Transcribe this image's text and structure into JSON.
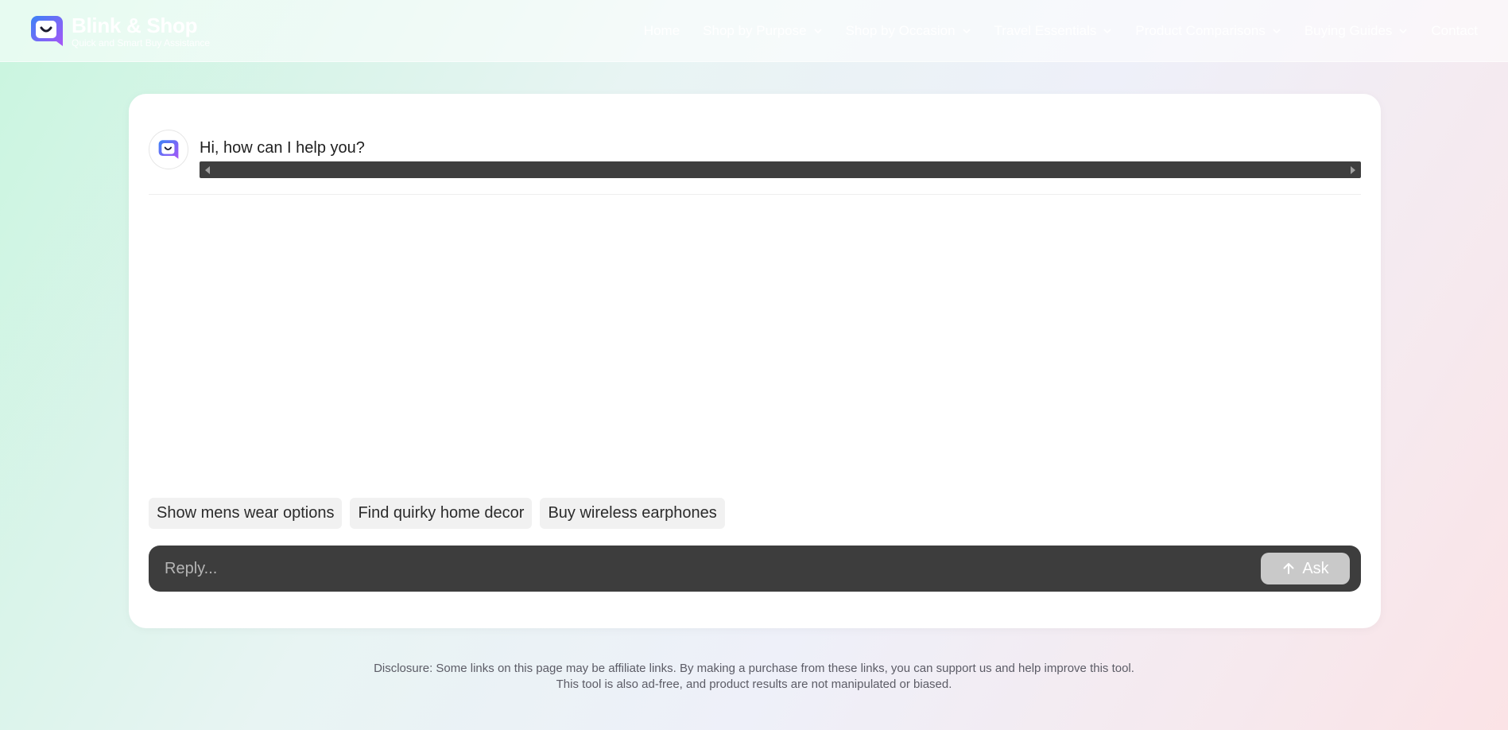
{
  "header": {
    "brand_name": "Blink & Shop",
    "tagline": "Quick and Smart Buy Assistance",
    "logo_icon": "smile-chat-icon",
    "nav": [
      {
        "label": "Home",
        "has_dropdown": false
      },
      {
        "label": "Shop by Purpose",
        "has_dropdown": true
      },
      {
        "label": "Shop by Occasion",
        "has_dropdown": true
      },
      {
        "label": "Travel Essentials",
        "has_dropdown": true
      },
      {
        "label": "Product Comparisons",
        "has_dropdown": true
      },
      {
        "label": "Buying Guides",
        "has_dropdown": true
      },
      {
        "label": "Contact",
        "has_dropdown": false
      }
    ]
  },
  "chat": {
    "greeting": "Hi, how can I help you?",
    "suggestions": [
      "Show mens wear options",
      "Find quirky home decor",
      "Buy wireless earphones"
    ],
    "reply_placeholder": "Reply...",
    "ask_label": "Ask"
  },
  "footer": {
    "disclosure_line1": "Disclosure: Some links on this page may be affiliate links. By making a purchase from these links, you can support us and help improve this tool.",
    "disclosure_line2": "This tool is also ad-free, and product results are not manipulated or biased."
  },
  "colors": {
    "logo_gradient_start": "#3b82f6",
    "logo_gradient_end": "#a855f7",
    "reply_bar": "#3d3d3d",
    "ask_button": "#c9c9c9"
  }
}
